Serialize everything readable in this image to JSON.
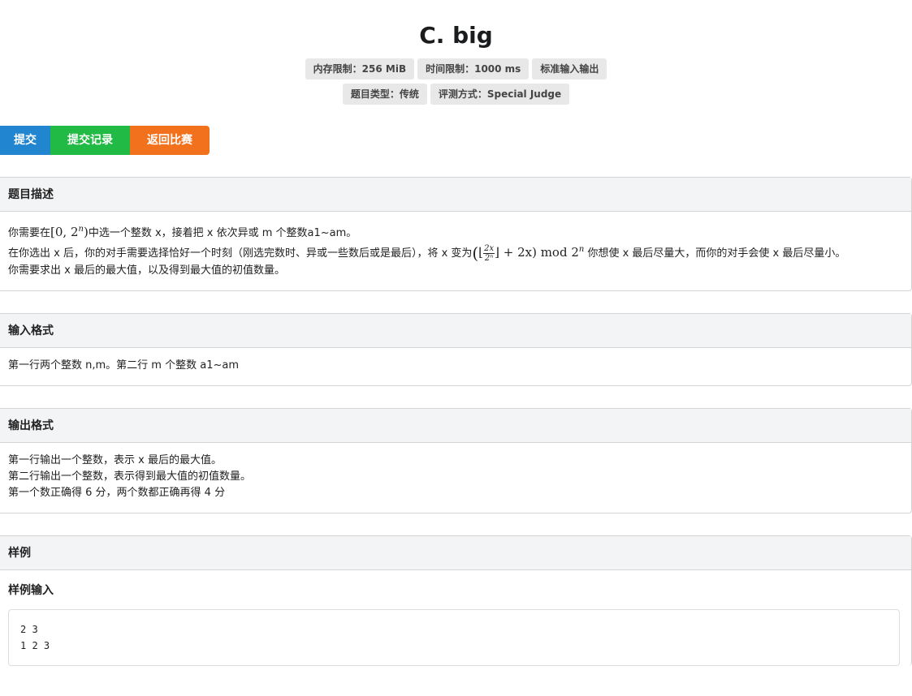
{
  "problem": {
    "title": "C. big",
    "badges_row1": [
      "内存限制：256 MiB",
      "时间限制：1000 ms",
      "标准输入输出"
    ],
    "badges_row2": [
      "题目类型：传统",
      "评测方式：Special Judge"
    ]
  },
  "actions": {
    "submit": "提交",
    "records": "提交记录",
    "back": "返回比赛"
  },
  "description": {
    "heading": "题目描述",
    "line1_pre": "你需要在",
    "line1_math": "[0, 2",
    "line1_sup": "n",
    "line1_math_close": ")",
    "line1_post": "中选一个整数 x，接着把 x 依次异或 m 个整数a1~am。",
    "line2_pre": "在你选出 x 后，你的对手需要选择恰好一个时刻（刚选完数时、异或一些数后或是最后），将 x 变为",
    "line2_frac_num": "2x",
    "line2_frac_den": "2ⁿ",
    "line2_math_rest": "+ 2x) mod 2",
    "line2_math_sup": "n",
    "line2_post": " 你想使 x 最后尽量大，而你的对手会使 x 最后尽量小。",
    "line3": "你需要求出 x 最后的最大值，以及得到最大值的初值数量。"
  },
  "input_format": {
    "heading": "输入格式",
    "text": "第一行两个整数 n,m。第二行 m 个整数 a1~am"
  },
  "output_format": {
    "heading": "输出格式",
    "lines": [
      "第一行输出一个整数，表示 x 最后的最大值。",
      "第二行输出一个整数，表示得到最大值的初值数量。",
      "第一个数正确得 6 分，两个数都正确再得 4 分"
    ]
  },
  "sample": {
    "heading": "样例",
    "input_label": "样例输入",
    "input_text": "2 3\n1 2 3"
  }
}
